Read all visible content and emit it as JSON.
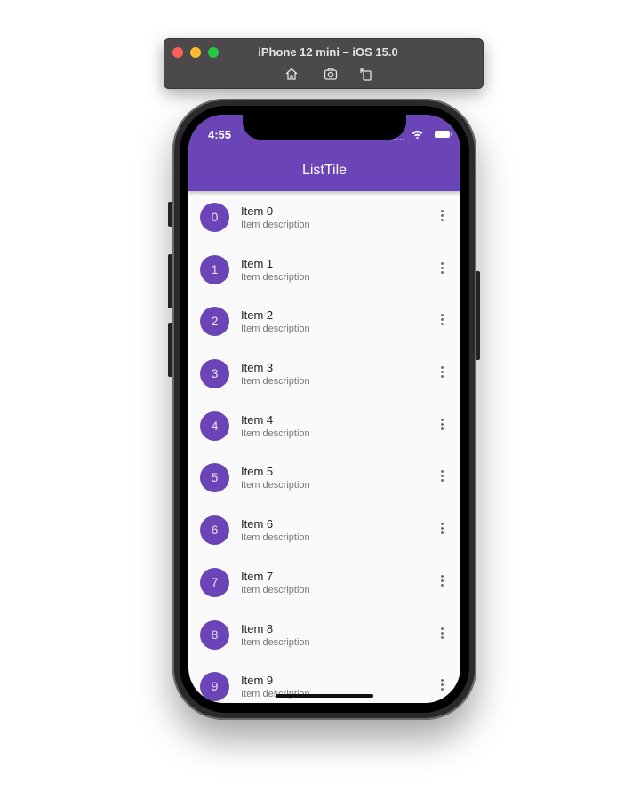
{
  "simulator": {
    "title": "iPhone 12 mini – iOS 15.0",
    "tools": [
      "home-icon",
      "screenshot-icon",
      "rotate-icon"
    ]
  },
  "status_bar": {
    "time": "4:55",
    "signal": "....",
    "icons": [
      "wifi-icon",
      "battery-icon"
    ]
  },
  "appbar": {
    "title": "ListTile",
    "color": "#6b44b7"
  },
  "list": {
    "items": [
      {
        "avatar": "0",
        "title": "Item 0",
        "subtitle": "Item description"
      },
      {
        "avatar": "1",
        "title": "Item 1",
        "subtitle": "Item description"
      },
      {
        "avatar": "2",
        "title": "Item 2",
        "subtitle": "Item description"
      },
      {
        "avatar": "3",
        "title": "Item 3",
        "subtitle": "Item description"
      },
      {
        "avatar": "4",
        "title": "Item 4",
        "subtitle": "Item description"
      },
      {
        "avatar": "5",
        "title": "Item 5",
        "subtitle": "Item description"
      },
      {
        "avatar": "6",
        "title": "Item 6",
        "subtitle": "Item description"
      },
      {
        "avatar": "7",
        "title": "Item 7",
        "subtitle": "Item description"
      },
      {
        "avatar": "8",
        "title": "Item 8",
        "subtitle": "Item description"
      },
      {
        "avatar": "9",
        "title": "Item 9",
        "subtitle": "Item description"
      }
    ],
    "trailing_icon": "more-vert-icon"
  }
}
